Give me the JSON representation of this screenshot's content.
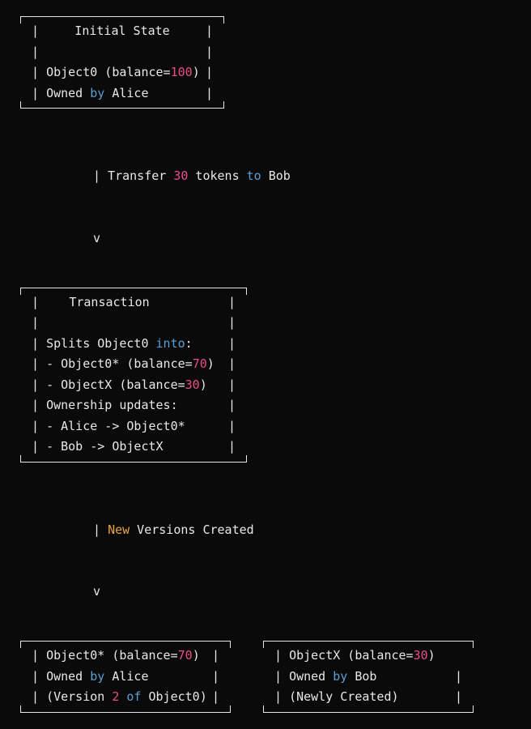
{
  "box1": {
    "title": "Initial State",
    "line1_a": "Object0 (balance=",
    "line1_b": "100",
    "line1_c": ")",
    "line2_a": "Owned ",
    "line2_b": "by",
    "line2_c": " Alice"
  },
  "arrow1": {
    "line1_a": "| Transfer ",
    "line1_b": "30",
    "line1_c": " tokens ",
    "line1_d": "to",
    "line1_e": " Bob",
    "line2": "v"
  },
  "box2": {
    "title": "Transaction",
    "line1_a": "Splits Object0 ",
    "line1_b": "into",
    "line1_c": ":",
    "line2_a": " - Object0* (balance=",
    "line2_b": "70",
    "line2_c": ")",
    "line3_a": " - ObjectX (balance=",
    "line3_b": "30",
    "line3_c": ")",
    "line4": "Ownership updates:",
    "line5": " - Alice -> Object0*",
    "line6": " - Bob -> ObjectX"
  },
  "arrow2": {
    "line1_a": "| ",
    "line1_b": "New",
    "line1_c": " Versions Created",
    "line2": "v"
  },
  "box3": {
    "line1_a": "Object0* (balance=",
    "line1_b": "70",
    "line1_c": ")",
    "line2_a": "Owned ",
    "line2_b": "by",
    "line2_c": " Alice",
    "line3_a": "(Version ",
    "line3_b": "2",
    "line3_c": " ",
    "line3_d": "of",
    "line3_e": " Object0)"
  },
  "box4": {
    "line1_a": "ObjectX (balance=",
    "line1_b": "30",
    "line1_c": ")",
    "line2_a": " Owned ",
    "line2_b": "by",
    "line2_c": " Bob",
    "line3": " (Newly Created)"
  }
}
